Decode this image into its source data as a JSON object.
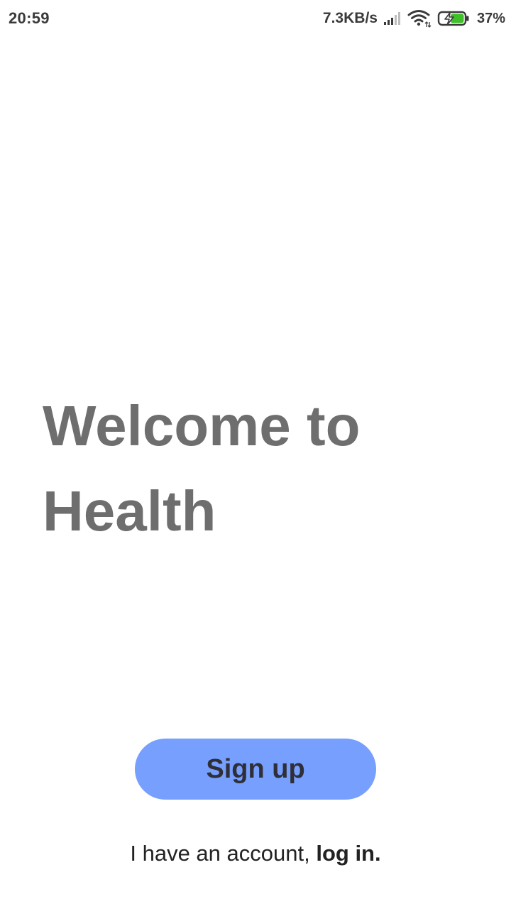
{
  "status_bar": {
    "time": "20:59",
    "network_speed": "7.3KB/s",
    "battery_percent": "37%",
    "battery_color": "#3fbf2a",
    "icons": [
      "signal-icon",
      "wifi-icon",
      "battery-charging-icon"
    ]
  },
  "welcome": {
    "line1": "Welcome to",
    "line2": "Health",
    "color": "#6e6e6e"
  },
  "signup": {
    "label": "Sign up",
    "background": "#779ffd"
  },
  "login": {
    "prefix": "I have an account, ",
    "link_label": "log in."
  }
}
